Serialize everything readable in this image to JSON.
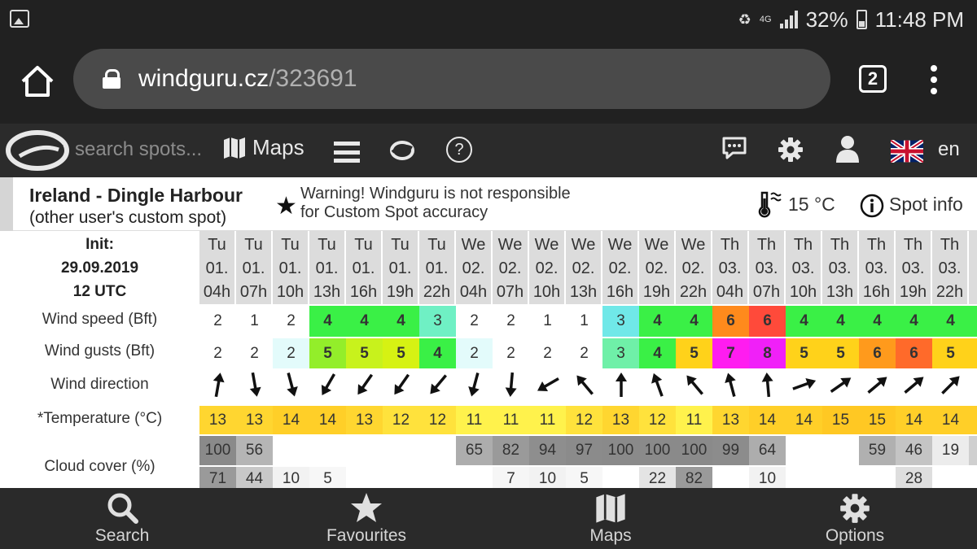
{
  "status_bar": {
    "battery": "32%",
    "time": "11:48 PM",
    "network": "4G"
  },
  "browser": {
    "url_domain": "windguru.cz",
    "url_path": "/323691",
    "tab_count": "2"
  },
  "site_header": {
    "search_placeholder": "search spots...",
    "maps_label": "Maps",
    "language": "en"
  },
  "spot": {
    "name": "Ireland - Dingle Harbour",
    "subtitle": "(other user's custom spot)",
    "warning_line1": "Warning! Windguru is not responsible",
    "warning_line2": "for Custom Spot accuracy",
    "temperature": "15 °C",
    "info_label": "Spot info"
  },
  "forecast": {
    "init_label": "Init:",
    "init_date": "29.09.2019",
    "init_time": "12 UTC",
    "row_labels": {
      "wind_speed": "Wind speed (Bft)",
      "wind_gusts": "Wind gusts (Bft)",
      "wind_direction": "Wind direction",
      "temperature": "*Temperature (°C)",
      "cloud_cover": "Cloud cover (%)"
    },
    "columns": [
      {
        "day": "Tu",
        "date": "01.",
        "hour": "04h",
        "wind": "2",
        "gust": "2",
        "dir": 10,
        "temp": "13",
        "cloud_hi": "100",
        "cloud_mid": "71",
        "wc": "#ffffff",
        "gc": "#ffffff",
        "tc": "#ffd630",
        "chc": "#8a8a8a",
        "cmc": "#9a9a9a"
      },
      {
        "day": "Tu",
        "date": "01.",
        "hour": "07h",
        "wind": "1",
        "gust": "2",
        "dir": 170,
        "temp": "13",
        "cloud_hi": "56",
        "cloud_mid": "44",
        "wc": "#ffffff",
        "gc": "#ffffff",
        "tc": "#ffd630",
        "chc": "#b5b5b5",
        "cmc": "#c8c8c8"
      },
      {
        "day": "Tu",
        "date": "01.",
        "hour": "10h",
        "wind": "2",
        "gust": "2",
        "dir": 165,
        "temp": "14",
        "cloud_hi": "",
        "cloud_mid": "10",
        "wc": "#ffffff",
        "gc": "#e3fbfb",
        "tc": "#ffcf28",
        "chc": "#ffffff",
        "cmc": "#f2f2f2"
      },
      {
        "day": "Tu",
        "date": "01.",
        "hour": "13h",
        "wind": "4",
        "gust": "5",
        "dir": 210,
        "temp": "14",
        "cloud_hi": "",
        "cloud_mid": "5",
        "wc": "#3af046",
        "gc": "#93ee2a",
        "tc": "#ffcf28",
        "chc": "#ffffff",
        "cmc": "#f7f7f7"
      },
      {
        "day": "Tu",
        "date": "01.",
        "hour": "16h",
        "wind": "4",
        "gust": "5",
        "dir": 215,
        "temp": "13",
        "cloud_hi": "",
        "cloud_mid": "",
        "wc": "#3af046",
        "gc": "#c8f21c",
        "tc": "#ffd630",
        "chc": "#ffffff",
        "cmc": "#ffffff"
      },
      {
        "day": "Tu",
        "date": "01.",
        "hour": "19h",
        "wind": "4",
        "gust": "5",
        "dir": 215,
        "temp": "12",
        "cloud_hi": "",
        "cloud_mid": "",
        "wc": "#3af046",
        "gc": "#d6f213",
        "tc": "#ffe23c",
        "chc": "#ffffff",
        "cmc": "#ffffff"
      },
      {
        "day": "Tu",
        "date": "01.",
        "hour": "22h",
        "wind": "3",
        "gust": "4",
        "dir": 220,
        "temp": "12",
        "cloud_hi": "",
        "cloud_mid": "",
        "wc": "#6ff0c4",
        "gc": "#3af046",
        "tc": "#ffe23c",
        "chc": "#ffffff",
        "cmc": "#ffffff"
      },
      {
        "day": "We",
        "date": "02.",
        "hour": "04h",
        "wind": "2",
        "gust": "2",
        "dir": 195,
        "temp": "11",
        "cloud_hi": "65",
        "cloud_mid": "",
        "wc": "#ffffff",
        "gc": "#e3fbfb",
        "tc": "#fff24c",
        "chc": "#adadad",
        "cmc": "#ffffff"
      },
      {
        "day": "We",
        "date": "02.",
        "hour": "07h",
        "wind": "2",
        "gust": "2",
        "dir": 185,
        "temp": "11",
        "cloud_hi": "82",
        "cloud_mid": "7",
        "wc": "#ffffff",
        "gc": "#ffffff",
        "tc": "#fff24c",
        "chc": "#9a9a9a",
        "cmc": "#f6f6f6"
      },
      {
        "day": "We",
        "date": "02.",
        "hour": "10h",
        "wind": "1",
        "gust": "2",
        "dir": 240,
        "temp": "11",
        "cloud_hi": "94",
        "cloud_mid": "10",
        "wc": "#ffffff",
        "gc": "#ffffff",
        "tc": "#fff24c",
        "chc": "#8e8e8e",
        "cmc": "#f2f2f2"
      },
      {
        "day": "We",
        "date": "02.",
        "hour": "13h",
        "wind": "1",
        "gust": "2",
        "dir": 320,
        "temp": "12",
        "cloud_hi": "97",
        "cloud_mid": "5",
        "wc": "#ffffff",
        "gc": "#ffffff",
        "tc": "#ffe23c",
        "chc": "#8b8b8b",
        "cmc": "#f7f7f7"
      },
      {
        "day": "We",
        "date": "02.",
        "hour": "16h",
        "wind": "3",
        "gust": "3",
        "dir": 0,
        "temp": "13",
        "cloud_hi": "100",
        "cloud_mid": "",
        "wc": "#70e8e8",
        "gc": "#6ff0a8",
        "tc": "#ffd630",
        "chc": "#8a8a8a",
        "cmc": "#ffffff"
      },
      {
        "day": "We",
        "date": "02.",
        "hour": "19h",
        "wind": "4",
        "gust": "4",
        "dir": 340,
        "temp": "12",
        "cloud_hi": "100",
        "cloud_mid": "22",
        "wc": "#3af046",
        "gc": "#3af046",
        "tc": "#ffe23c",
        "chc": "#8a8a8a",
        "cmc": "#e4e4e4"
      },
      {
        "day": "We",
        "date": "02.",
        "hour": "22h",
        "wind": "4",
        "gust": "5",
        "dir": 320,
        "temp": "11",
        "cloud_hi": "100",
        "cloud_mid": "82",
        "wc": "#3af046",
        "gc": "#ffd21a",
        "tc": "#fff24c",
        "chc": "#8a8a8a",
        "cmc": "#9a9a9a"
      },
      {
        "day": "Th",
        "date": "03.",
        "hour": "04h",
        "wind": "6",
        "gust": "7",
        "dir": 345,
        "temp": "13",
        "cloud_hi": "99",
        "cloud_mid": "",
        "wc": "#ff8a1c",
        "gc": "#ff1cf0",
        "tc": "#ffd630",
        "chc": "#8c8c8c",
        "cmc": "#ffffff"
      },
      {
        "day": "Th",
        "date": "03.",
        "hour": "07h",
        "wind": "6",
        "gust": "8",
        "dir": 355,
        "temp": "14",
        "cloud_hi": "64",
        "cloud_mid": "10",
        "wc": "#ff4a3a",
        "gc": "#f020f8",
        "tc": "#ffcf28",
        "chc": "#adadad",
        "cmc": "#f2f2f2"
      },
      {
        "day": "Th",
        "date": "03.",
        "hour": "10h",
        "wind": "4",
        "gust": "5",
        "dir": 70,
        "temp": "14",
        "cloud_hi": "",
        "cloud_mid": "",
        "wc": "#3af046",
        "gc": "#ffd21a",
        "tc": "#ffcf28",
        "chc": "#ffffff",
        "cmc": "#ffffff"
      },
      {
        "day": "Th",
        "date": "03.",
        "hour": "13h",
        "wind": "4",
        "gust": "5",
        "dir": 55,
        "temp": "15",
        "cloud_hi": "",
        "cloud_mid": "",
        "wc": "#3af046",
        "gc": "#ffd21a",
        "tc": "#ffc823",
        "chc": "#ffffff",
        "cmc": "#ffffff"
      },
      {
        "day": "Th",
        "date": "03.",
        "hour": "16h",
        "wind": "4",
        "gust": "6",
        "dir": 50,
        "temp": "15",
        "cloud_hi": "59",
        "cloud_mid": "",
        "wc": "#3af046",
        "gc": "#ff9a1c",
        "tc": "#ffc823",
        "chc": "#b0b0b0",
        "cmc": "#ffffff"
      },
      {
        "day": "Th",
        "date": "03.",
        "hour": "19h",
        "wind": "4",
        "gust": "6",
        "dir": 50,
        "temp": "14",
        "cloud_hi": "46",
        "cloud_mid": "28",
        "wc": "#3af046",
        "gc": "#ff6a2a",
        "tc": "#ffcf28",
        "chc": "#c4c4c4",
        "cmc": "#dedede"
      },
      {
        "day": "Th",
        "date": "03.",
        "hour": "22h",
        "wind": "4",
        "gust": "5",
        "dir": 45,
        "temp": "14",
        "cloud_hi": "19",
        "cloud_mid": "",
        "wc": "#3af046",
        "gc": "#ffd21a",
        "tc": "#ffcf28",
        "chc": "#ececec",
        "cmc": "#ffffff"
      },
      {
        "day": "",
        "date": "0",
        "hour": "",
        "wind": "",
        "gust": "",
        "dir": 45,
        "temp": "",
        "cloud_hi": "1",
        "cloud_mid": "",
        "wc": "#3af046",
        "gc": "#ffd21a",
        "tc": "#ffcf28",
        "chc": "#cfcfcf",
        "cmc": "#ffffff"
      }
    ]
  },
  "bottom_nav": {
    "search": "Search",
    "favourites": "Favourites",
    "maps": "Maps",
    "options": "Options"
  }
}
